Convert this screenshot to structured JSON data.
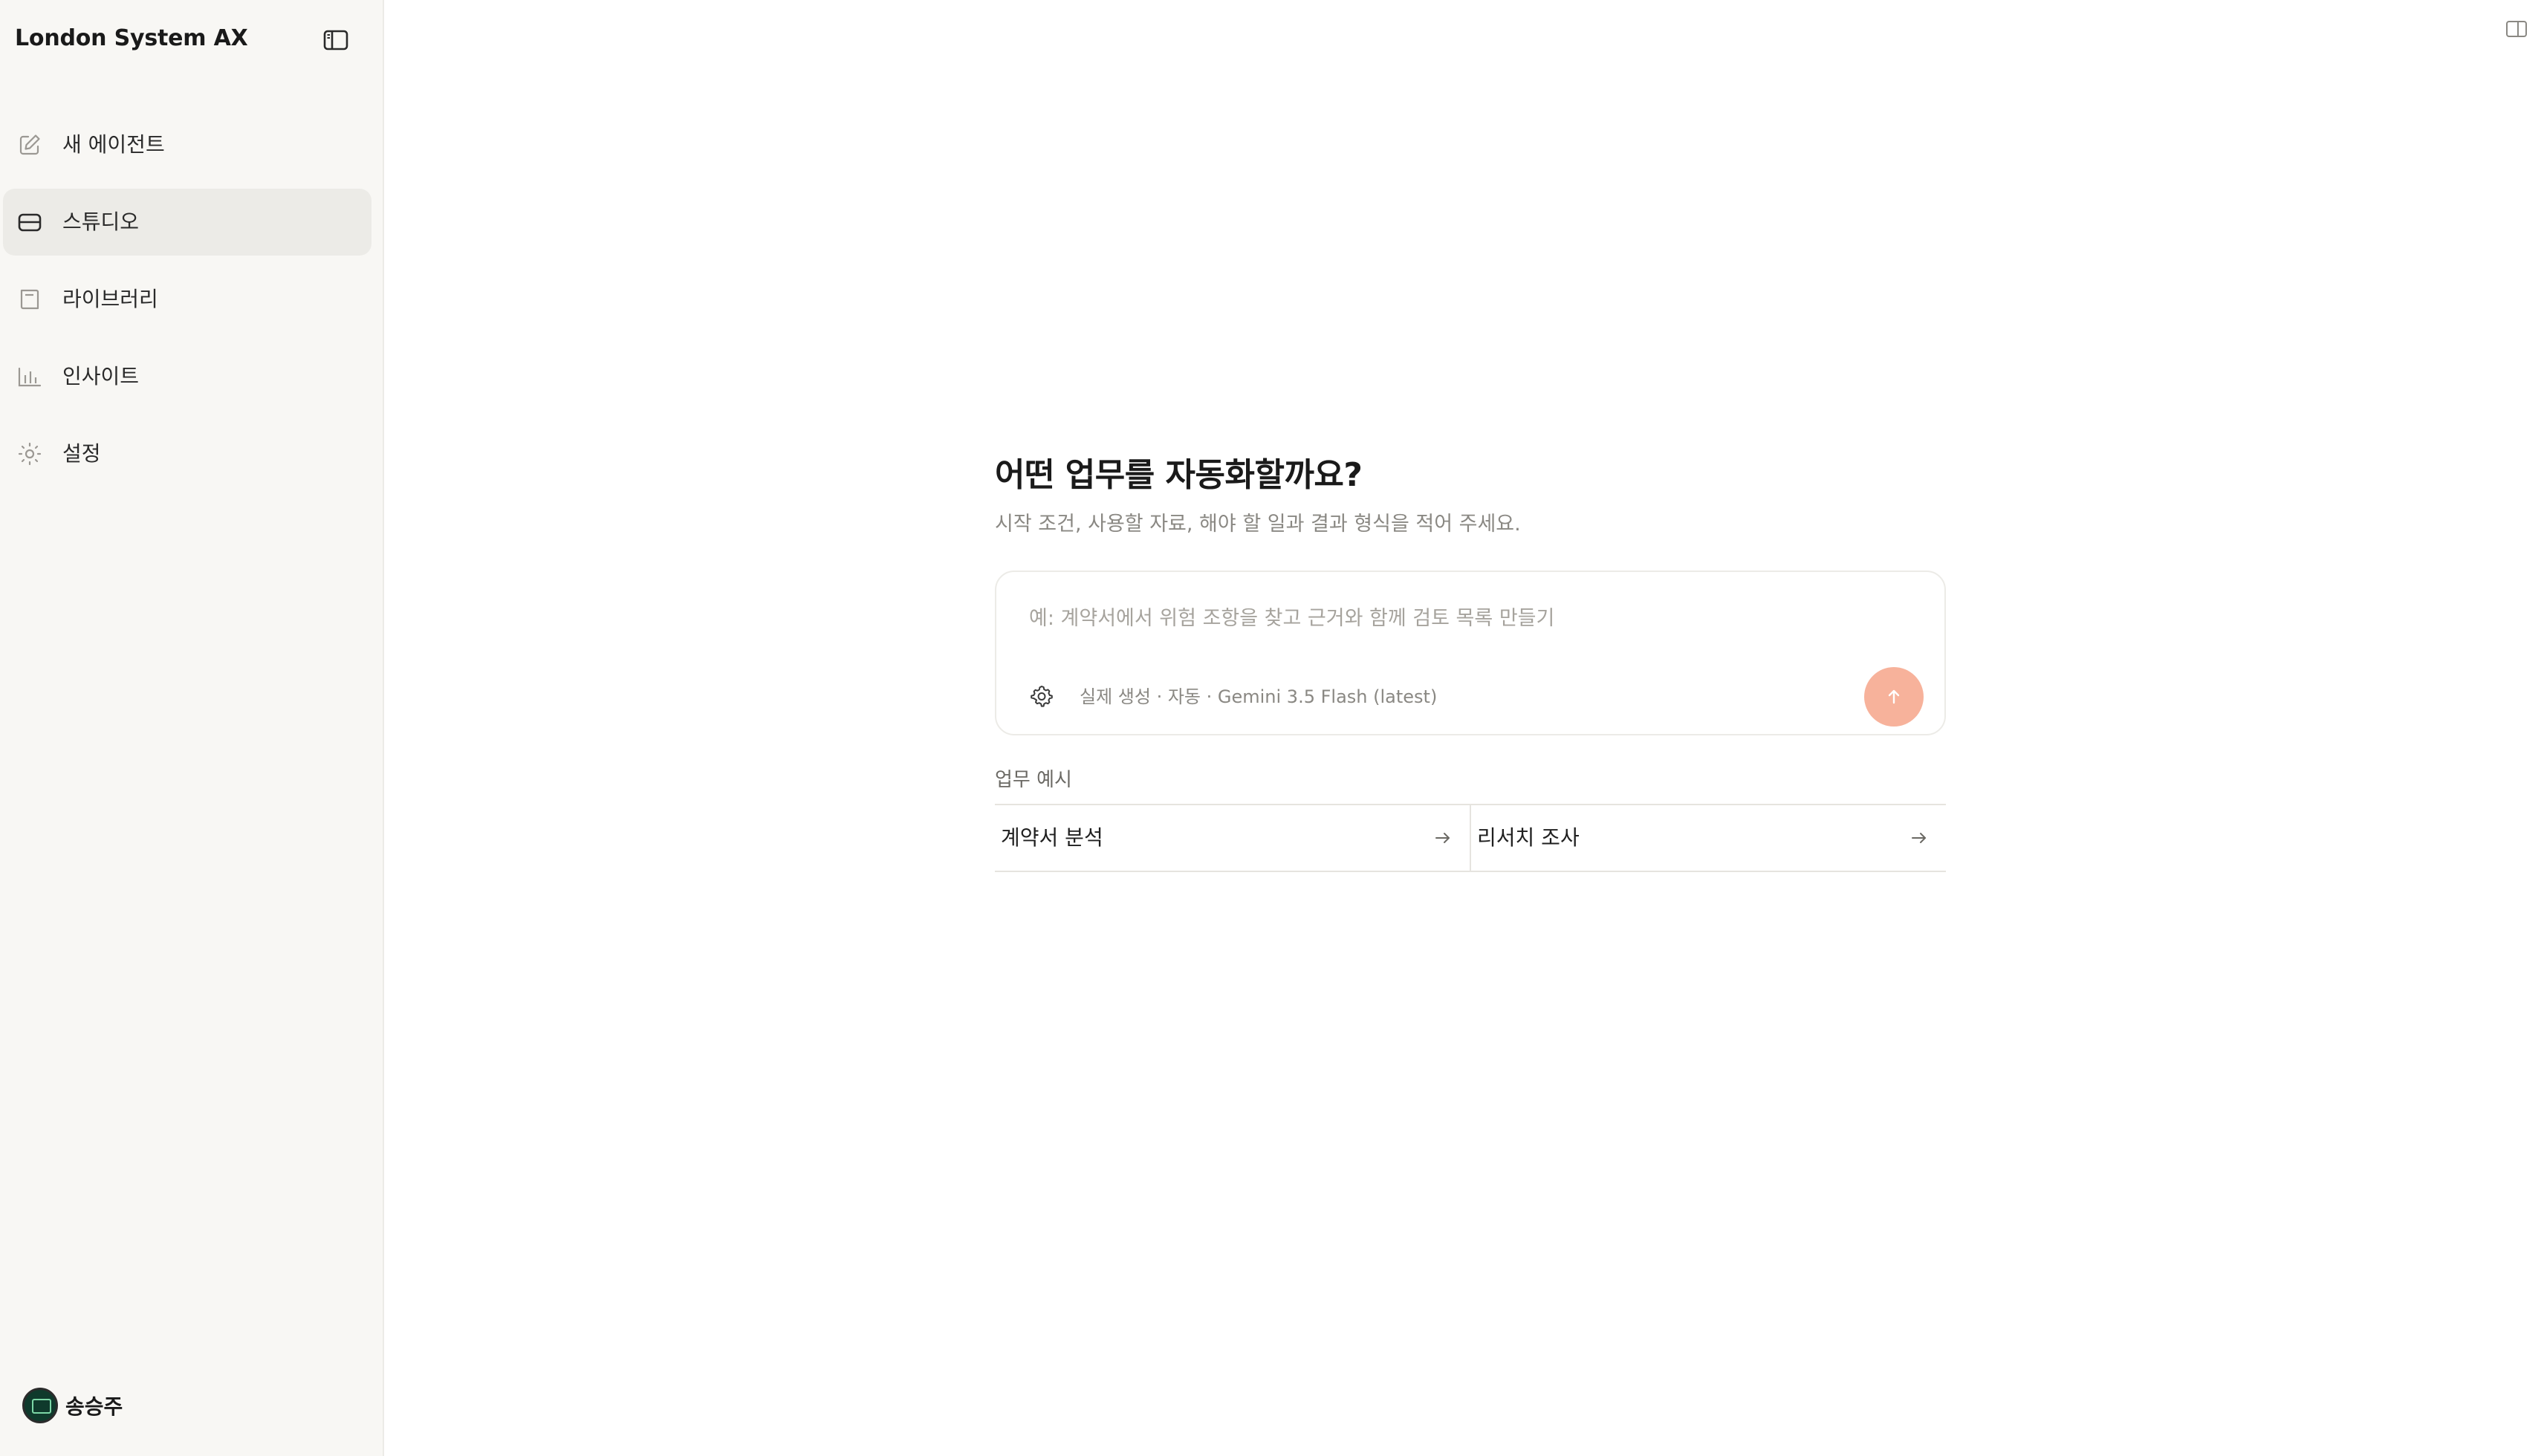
{
  "sidebar": {
    "brand": "London System AX",
    "items": [
      {
        "label": "새 에이전트",
        "icon": "edit-icon",
        "active": false
      },
      {
        "label": "스튜디오",
        "icon": "inbox-icon",
        "active": true
      },
      {
        "label": "라이브러리",
        "icon": "book-icon",
        "active": false
      },
      {
        "label": "인사이트",
        "icon": "bar-chart-icon",
        "active": false
      },
      {
        "label": "설정",
        "icon": "sun-icon",
        "active": false
      }
    ],
    "user": {
      "name": "송승주"
    }
  },
  "main": {
    "heading": "어떤 업무를 자동화할까요?",
    "subheading": "시작 조건, 사용할 자료, 해야 할 일과 결과 형식을 적어 주세요.",
    "composer": {
      "placeholder": "예: 계약서에서 위험 조항을 찾고 근거와 함께 검토 목록 만들기",
      "value": "",
      "model_info": "실제 생성 · 자동 · Gemini 3.5 Flash (latest)"
    },
    "examples": {
      "title": "업무 예시",
      "items": [
        {
          "label": "계약서 분석"
        },
        {
          "label": "리서치 조사"
        }
      ]
    }
  },
  "colors": {
    "sidebar_bg": "#f8f7f4",
    "active_item_bg": "#ecebe7",
    "send_button": "#f7b29b",
    "muted_text": "#8a8883"
  }
}
